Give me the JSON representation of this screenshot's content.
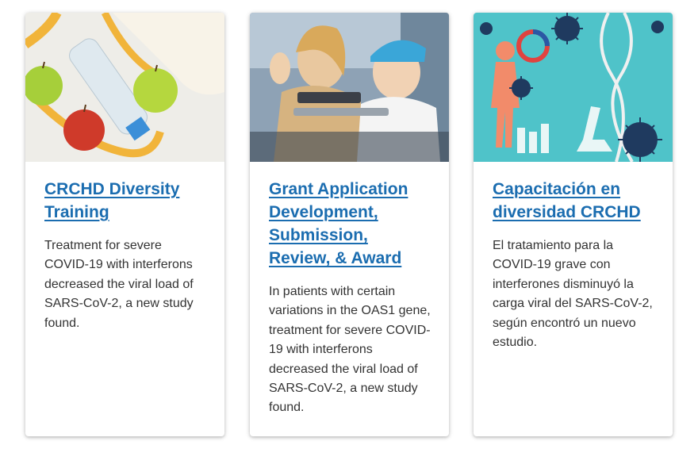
{
  "cards": [
    {
      "image": "fitness-still-life-photo",
      "title": "CRCHD Diversity Training",
      "text": "Treatment for severe COVID-19 with interferons decreased the viral load of SARS-CoV-2, a new study found."
    },
    {
      "image": "patient-video-call-photo",
      "title": "Grant Application Development, Submission, Review, & Award",
      "text": "In patients with certain variations in the OAS1 gene, treatment for severe COVID-19 with interferons decreased the viral load of SARS-CoV-2, a new study found."
    },
    {
      "image": "virus-dna-illustration",
      "title": "Capacitación en diversidad CRCHD",
      "text": "El tratamiento para la COVID-19 grave con interferones disminuyó la carga viral del SARS-CoV-2, según encontró un nuevo estudio."
    }
  ],
  "colors": {
    "link": "#1b6db0",
    "body_text": "#333333",
    "illustration_bg": "#4fc3c9"
  }
}
